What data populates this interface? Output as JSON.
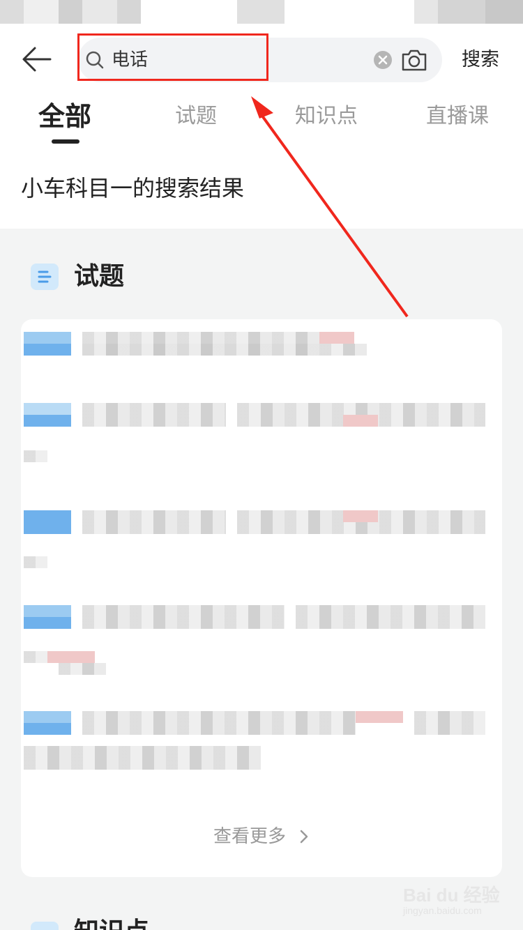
{
  "header": {
    "search_query": "电话",
    "search_button_label": "搜索"
  },
  "tabs": [
    {
      "label": "全部",
      "active": true
    },
    {
      "label": "试题",
      "active": false
    },
    {
      "label": "知识点",
      "active": false
    },
    {
      "label": "直播课",
      "active": false
    }
  ],
  "results_title": "小车科目一的搜索结果",
  "sections": {
    "questions_title": "试题",
    "see_more_label": "查看更多",
    "next_section_title": "知识点"
  },
  "watermark": {
    "text": "Bai du 经验",
    "sub": "jingyan.baidu.com"
  },
  "colors": {
    "highlight": "#f0271d",
    "accent_blue": "#6fb1ec",
    "background": "#f3f4f4"
  },
  "icons": {
    "back": "arrow-left-icon",
    "search": "magnifier-icon",
    "clear": "close-circle-icon",
    "camera": "camera-icon",
    "section": "list-icon",
    "chevron": "chevron-right-icon"
  }
}
